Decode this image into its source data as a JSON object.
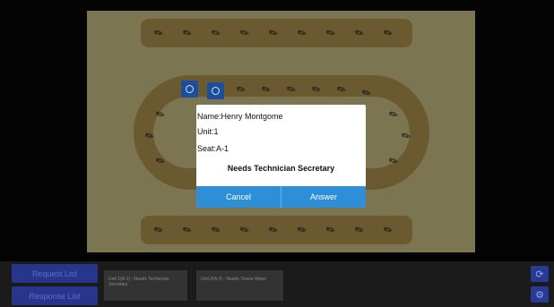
{
  "dialog": {
    "name": "Name:Henry Montgome",
    "unit": "Unit:1",
    "seat": "Seat:A-1",
    "message": "Needs Technician Secretary",
    "cancel_label": "Cancel",
    "answer_label": "Answer"
  },
  "bottom": {
    "request_list_label": "Request List",
    "response_list_label": "Response List",
    "requests": [
      {
        "text": "Unit 1(A-1) : Needs Technician Secretary"
      },
      {
        "text": "Unit 2(A-2) : Needs Tissue Water"
      }
    ]
  },
  "icons": {
    "seat": "seat-icon",
    "refresh": "refresh-icon",
    "settings": "gear-icon"
  },
  "colors": {
    "accent": "#2f8fd6",
    "highlight_seat": "#1e4e9a",
    "table": "#6b5a2f"
  }
}
